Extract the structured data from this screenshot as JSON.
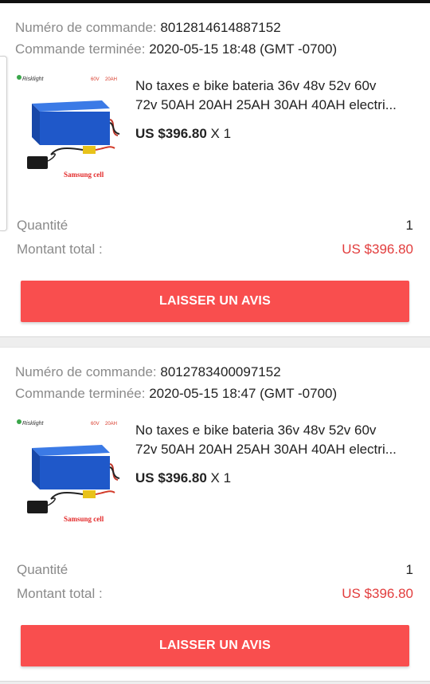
{
  "orders": [
    {
      "order_number_label": "Numéro de commande:",
      "order_number": "8012814614887152",
      "completed_label": "Commande terminée:",
      "completed_date": "2020-05-15 18:48 (GMT -0700)",
      "image": {
        "brand": "Risklight",
        "volt": "60V",
        "ah": "20AH",
        "caption": "Samsung cell"
      },
      "title_line1": "No taxes  e bike bateria 36v 48v 52v 60v",
      "title_line2": "72v 50AH 20AH 25AH 30AH 40AH electri...",
      "price": "US $396.80",
      "qty_suffix": "X 1",
      "quantity_label": "Quantité",
      "quantity": "1",
      "total_label": "Montant total :",
      "total": "US $396.80",
      "review_button": "LAISSER UN AVIS"
    },
    {
      "order_number_label": "Numéro de commande:",
      "order_number": "8012783400097152",
      "completed_label": "Commande terminée:",
      "completed_date": "2020-05-15 18:47 (GMT -0700)",
      "image": {
        "brand": "Risklight",
        "volt": "60V",
        "ah": "20AH",
        "caption": "Samsung cell"
      },
      "title_line1": "No taxes  e bike bateria 36v 48v 52v 60v",
      "title_line2": "72v 50AH 20AH 25AH 30AH 40AH electri...",
      "price": "US $396.80",
      "qty_suffix": "X 1",
      "quantity_label": "Quantité",
      "quantity": "1",
      "total_label": "Montant total :",
      "total": "US $396.80",
      "review_button": "LAISSER UN AVIS"
    }
  ],
  "colors": {
    "accent_button": "#f94e4e",
    "total_red": "#e23d3d",
    "label_gray": "#8a8a8a",
    "battery_blue": "#1f58c9"
  }
}
